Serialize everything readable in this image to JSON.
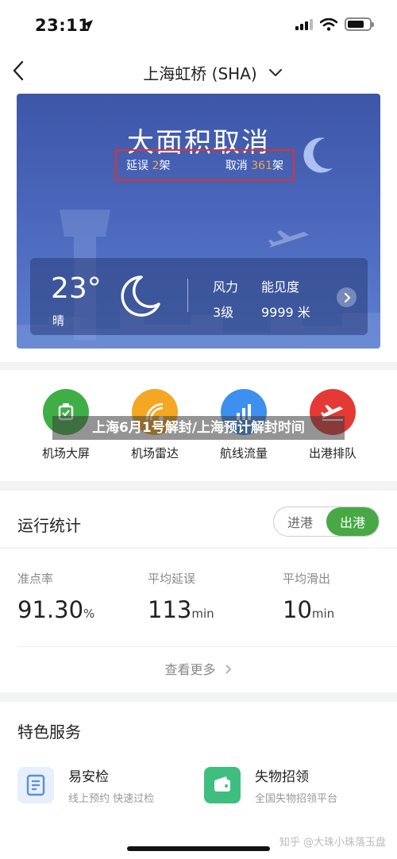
{
  "status_bar": {
    "time": "23:11"
  },
  "nav": {
    "title": "上海虹桥 (SHA)"
  },
  "hero": {
    "title": "大面积取消",
    "delay_prefix": "延误",
    "delay_count": "2",
    "delay_suffix": "架",
    "cancel_prefix": "取消",
    "cancel_count": "361",
    "cancel_suffix": "架"
  },
  "weather": {
    "temperature": "23°",
    "description": "晴",
    "wind_label": "风力",
    "wind_value": "3级",
    "visibility_label": "能见度",
    "visibility_value": "9999 米"
  },
  "shortcuts": [
    {
      "label": "机场大屏",
      "icon": "airport-screen-icon",
      "color": "#3fae45"
    },
    {
      "label": "机场雷达",
      "icon": "radar-icon",
      "color": "#f5a623"
    },
    {
      "label": "航线流量",
      "icon": "bar-chart-icon",
      "color": "#3d8ff0"
    },
    {
      "label": "出港排队",
      "icon": "departure-plane-icon",
      "color": "#e53935"
    }
  ],
  "overlay_caption": "上海6月1号解封/上海预计解封时间",
  "stats": {
    "title": "运行统计",
    "toggle_arrival": "进港",
    "toggle_departure": "出港",
    "active_toggle": "出港",
    "metrics": [
      {
        "label": "准点率",
        "value": "91.30",
        "unit": "%"
      },
      {
        "label": "平均延误",
        "value": "113",
        "unit": "min"
      },
      {
        "label": "平均滑出",
        "value": "10",
        "unit": "min"
      }
    ],
    "more": "查看更多"
  },
  "services": {
    "title": "特色服务",
    "items": [
      {
        "title": "易安检",
        "subtitle": "线上预约 快速过检",
        "icon": "security-check-icon",
        "color": "#5b8fd8"
      },
      {
        "title": "失物招领",
        "subtitle": "全国失物招领平台",
        "icon": "wallet-icon",
        "color": "#3fbf7f"
      }
    ]
  },
  "watermark": "知乎 @大珠小珠落玉盘",
  "colors": {
    "accent_green": "#47a845",
    "alert_red": "#e0312d",
    "count_orange": "#f5a54a",
    "hero_blue": "#4a66ba"
  }
}
